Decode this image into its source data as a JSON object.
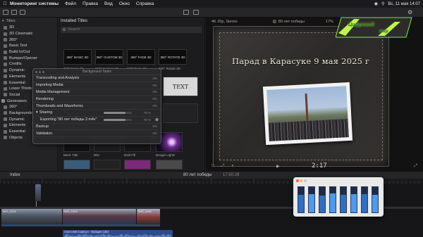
{
  "menubar": {
    "app_name": "Мониторинг системы",
    "items": [
      "Файл",
      "Правка",
      "Вид",
      "Окно",
      "Справка"
    ],
    "clock": "Вс, 11 мая 14:07"
  },
  "browser": {
    "title": "Installed Titles",
    "search_placeholder": "Search",
    "thumbs": [
      {
        "text": "360° BASIC 3D",
        "caption": "360° Basic 3D"
      },
      {
        "text": "360° CUSTOM 3D",
        "caption": "360° Custom 3D"
      },
      {
        "text": "360° FADE 3D",
        "caption": "360° Fade 3D"
      },
      {
        "text": "360° ROTATE 3D",
        "caption": "360° Rotate 3D"
      }
    ],
    "lower_labels": [
      "Basic Title",
      "Blur",
      "Bold Fill",
      "Boogie Lights"
    ]
  },
  "sidebar": {
    "header": "Titles",
    "items": [
      {
        "label": "3D",
        "selected": false
      },
      {
        "label": "3D Cinematic",
        "selected": false
      },
      {
        "label": "360°",
        "selected": false
      },
      {
        "label": "Basic Text",
        "selected": false
      },
      {
        "label": "Build In/Out",
        "selected": false
      },
      {
        "label": "Bumper/Opener",
        "selected": false
      },
      {
        "label": "Credits",
        "selected": false
      },
      {
        "label": "Dynamic",
        "selected": false
      },
      {
        "label": "Elements",
        "selected": false
      },
      {
        "label": "Essential",
        "selected": false
      },
      {
        "label": "Lower Thirds",
        "selected": false
      },
      {
        "label": "Social",
        "selected": false
      },
      {
        "label": "Generators",
        "selected": false
      },
      {
        "label": "360°",
        "selected": false
      },
      {
        "label": "Backgrounds",
        "selected": false
      },
      {
        "label": "Dynamic",
        "selected": false
      },
      {
        "label": "Elements",
        "selected": false
      },
      {
        "label": "Essential",
        "selected": false
      },
      {
        "label": "Objects",
        "selected": false
      }
    ]
  },
  "tasks": {
    "title": "Background Tasks",
    "rows": [
      {
        "label": "Transcoding and Analysis",
        "pct": "0%"
      },
      {
        "label": "Importing Media",
        "pct": "0%"
      },
      {
        "label": "Media Management",
        "pct": "0%"
      },
      {
        "label": "Rendering",
        "pct": "0%"
      },
      {
        "label": "Thumbnails and Waveforms",
        "pct": "0%"
      },
      {
        "label": "Sharing",
        "pct": "78 %",
        "progress": 0.78
      },
      {
        "label": "Exporting \"80 лет победы 2.m4v\"",
        "pct": "78 %",
        "progress": 0.78
      },
      {
        "label": "Backup",
        "pct": "0%"
      },
      {
        "label": "Validation",
        "pct": "0%"
      }
    ]
  },
  "viewer": {
    "format": "4K 30p, Stereo",
    "project": "80 лет победы",
    "zoom": "17%",
    "book_title": "Парад в Карасуке 9 мая 2025 г",
    "timecode": "2:17"
  },
  "logo": {
    "line1": "Цифровой",
    "line2": "мир"
  },
  "timeline": {
    "index_label": "Index",
    "project": "80 лет победы",
    "duration": "17:50:28",
    "clip_names": [
      "IMG_1025",
      "IMG_1026",
      "IMG_1030"
    ],
    "audio_label": "Анатолий Самсун - Вайщик СВО"
  },
  "meter": {
    "levels": [
      0.7,
      0.72,
      0.68,
      0.75,
      0.7,
      0.73,
      0.71,
      0.69
    ]
  },
  "colors": {
    "accent": "#3c8ee6",
    "clip_blue": "#2f4c8a",
    "logo_green": "#bff44d"
  }
}
